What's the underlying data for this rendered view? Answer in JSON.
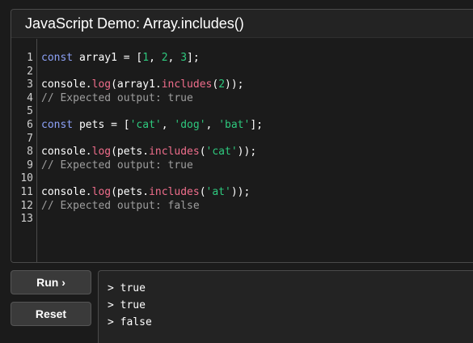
{
  "header": {
    "title": "JavaScript Demo: Array.includes()"
  },
  "editor": {
    "line_numbers": [
      "1",
      "2",
      "3",
      "4",
      "5",
      "6",
      "7",
      "8",
      "9",
      "10",
      "11",
      "12",
      "13"
    ],
    "lines": [
      [
        {
          "t": "kw",
          "v": "const"
        },
        {
          "t": "pl",
          "v": " array1 = ["
        },
        {
          "t": "num",
          "v": "1"
        },
        {
          "t": "pl",
          "v": ", "
        },
        {
          "t": "num",
          "v": "2"
        },
        {
          "t": "pl",
          "v": ", "
        },
        {
          "t": "num",
          "v": "3"
        },
        {
          "t": "pl",
          "v": "];"
        }
      ],
      [],
      [
        {
          "t": "pl",
          "v": "console."
        },
        {
          "t": "fn",
          "v": "log"
        },
        {
          "t": "pl",
          "v": "(array1."
        },
        {
          "t": "fn",
          "v": "includes"
        },
        {
          "t": "pl",
          "v": "("
        },
        {
          "t": "num",
          "v": "2"
        },
        {
          "t": "pl",
          "v": "));"
        }
      ],
      [
        {
          "t": "cm",
          "v": "// Expected output: true"
        }
      ],
      [],
      [
        {
          "t": "kw",
          "v": "const"
        },
        {
          "t": "pl",
          "v": " pets = ["
        },
        {
          "t": "str",
          "v": "'cat'"
        },
        {
          "t": "pl",
          "v": ", "
        },
        {
          "t": "str",
          "v": "'dog'"
        },
        {
          "t": "pl",
          "v": ", "
        },
        {
          "t": "str",
          "v": "'bat'"
        },
        {
          "t": "pl",
          "v": "];"
        }
      ],
      [],
      [
        {
          "t": "pl",
          "v": "console."
        },
        {
          "t": "fn",
          "v": "log"
        },
        {
          "t": "pl",
          "v": "(pets."
        },
        {
          "t": "fn",
          "v": "includes"
        },
        {
          "t": "pl",
          "v": "("
        },
        {
          "t": "str",
          "v": "'cat'"
        },
        {
          "t": "pl",
          "v": "));"
        }
      ],
      [
        {
          "t": "cm",
          "v": "// Expected output: true"
        }
      ],
      [],
      [
        {
          "t": "pl",
          "v": "console."
        },
        {
          "t": "fn",
          "v": "log"
        },
        {
          "t": "pl",
          "v": "(pets."
        },
        {
          "t": "fn",
          "v": "includes"
        },
        {
          "t": "pl",
          "v": "("
        },
        {
          "t": "str",
          "v": "'at'"
        },
        {
          "t": "pl",
          "v": "));"
        }
      ],
      [
        {
          "t": "cm",
          "v": "// Expected output: false"
        }
      ],
      []
    ]
  },
  "buttons": {
    "run_label": "Run ›",
    "reset_label": "Reset"
  },
  "console": {
    "lines": [
      "> true",
      "> true",
      "> false"
    ]
  },
  "colors": {
    "keyword": "#8da2f8",
    "number": "#2ec97e",
    "string": "#2ec97e",
    "function": "#f06e8c",
    "comment": "#9e9e9e",
    "background": "#1b1b1b"
  }
}
